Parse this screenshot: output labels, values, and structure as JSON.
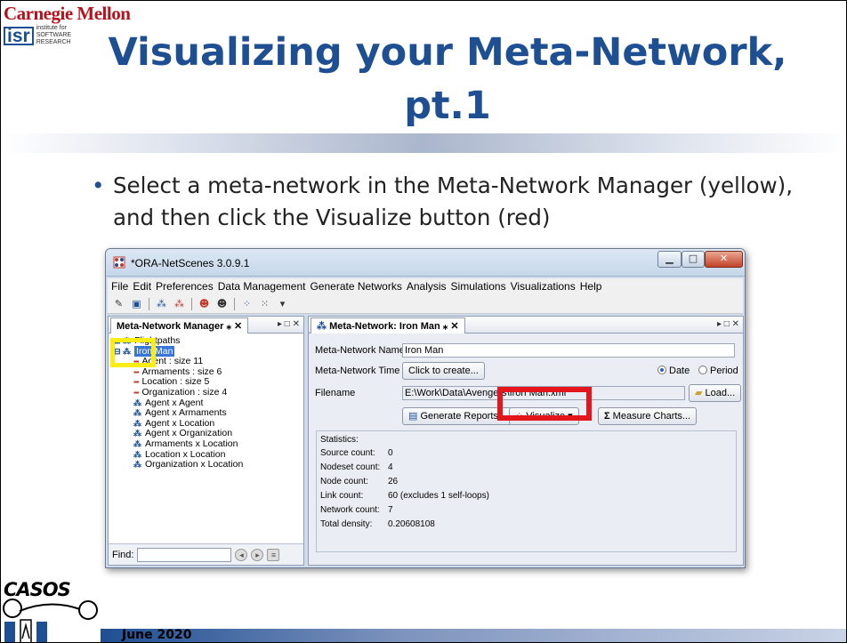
{
  "header": {
    "university": "Carnegie Mellon",
    "isr_mark": "isr",
    "isr_text": [
      "institute for",
      "SOFTWARE",
      "RESEARCH"
    ],
    "title_line1": "Visualizing your Meta-Network,",
    "title_line2": "pt.1"
  },
  "bullet": "Select a meta-network in the Meta-Network Manager (yellow), and then click the Visualize button (red)",
  "window": {
    "title": "*ORA-NetScenes 3.0.9.1",
    "menu": [
      "File",
      "Edit",
      "Preferences",
      "Data Management",
      "Generate Networks",
      "Analysis",
      "Simulations",
      "Visualizations",
      "Help"
    ],
    "left_panel": {
      "tab": "Meta-Network Manager",
      "tree": [
        {
          "label": "Flightpaths",
          "kind": "meta"
        },
        {
          "label": "Iron Man",
          "kind": "meta",
          "selected": true
        },
        {
          "label": "Agent : size 11",
          "kind": "nodeset"
        },
        {
          "label": "Armaments : size 6",
          "kind": "nodeset"
        },
        {
          "label": "Location : size 5",
          "kind": "nodeset"
        },
        {
          "label": "Organization : size 4",
          "kind": "nodeset"
        },
        {
          "label": "Agent x Agent",
          "kind": "network"
        },
        {
          "label": "Agent x Armaments",
          "kind": "network"
        },
        {
          "label": "Agent x Location",
          "kind": "network"
        },
        {
          "label": "Agent x Organization",
          "kind": "network"
        },
        {
          "label": "Armaments x Location",
          "kind": "network"
        },
        {
          "label": "Location x Location",
          "kind": "network"
        },
        {
          "label": "Organization x Location",
          "kind": "network"
        }
      ],
      "find_label": "Find:"
    },
    "right_panel": {
      "tab": "Meta-Network: Iron Man",
      "name_label": "Meta-Network Name",
      "name_value": "Iron Man",
      "time_label": "Meta-Network Time",
      "time_button": "Click to create...",
      "radio_date": "Date",
      "radio_period": "Period",
      "filename_label": "Filename",
      "filename_value": "E:\\Work\\Data\\Avengers\\Iron Man.xml",
      "load_button": "Load...",
      "reports_button": "Generate Reports...",
      "visualize_button": "Visualize",
      "charts_button": "Measure Charts...",
      "stats_label": "Statistics:",
      "stats": [
        {
          "k": "Source count:",
          "v": "0"
        },
        {
          "k": "Nodeset count:",
          "v": "4"
        },
        {
          "k": "Node count:",
          "v": "26"
        },
        {
          "k": "Link count:",
          "v": "60 (excludes 1 self-loops)"
        },
        {
          "k": "Network count:",
          "v": "7"
        },
        {
          "k": "Total density:",
          "v": "0.20608108"
        }
      ]
    }
  },
  "footer": {
    "logo_text": "CASOS",
    "date": "June 2020"
  },
  "colors": {
    "title": "#1f4f93",
    "cmu_red": "#b5121b",
    "highlight_yellow": "#f8ee15",
    "highlight_red": "#e4161c"
  }
}
